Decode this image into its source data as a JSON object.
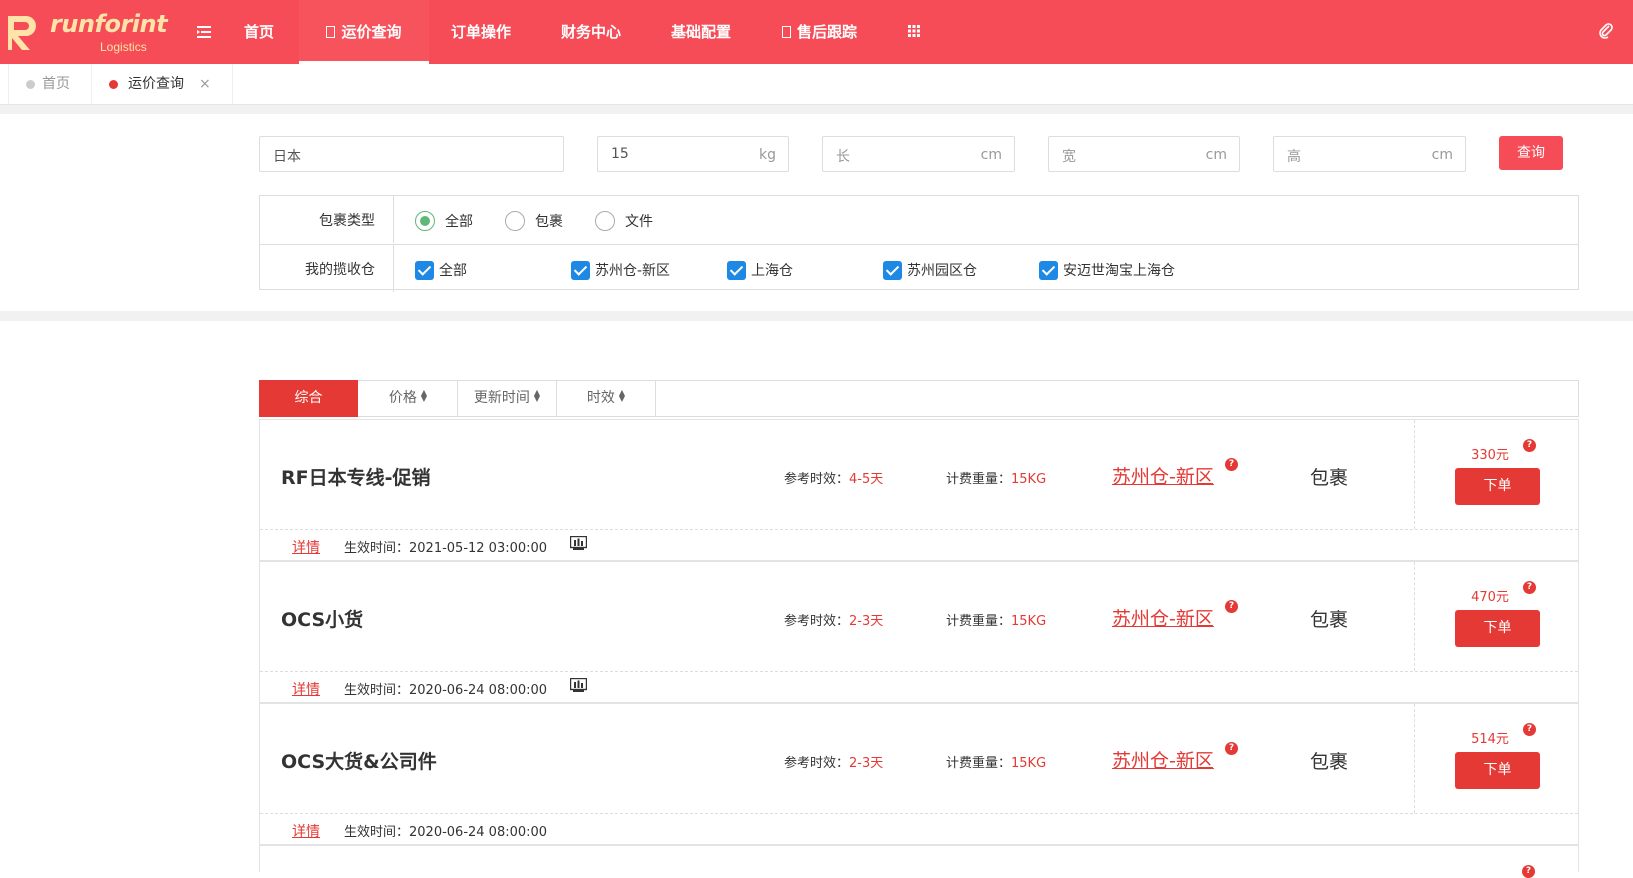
{
  "brand": {
    "name": "runforint",
    "sub": "Logistics"
  },
  "colors": {
    "primary": "#f64c57",
    "accent_red": "#e53935",
    "check_blue": "#1e88e5",
    "radio_green": "#5fb878"
  },
  "nav": [
    {
      "label": "首页"
    },
    {
      "label": "运价查询",
      "active": true
    },
    {
      "label": "订单操作"
    },
    {
      "label": "财务中心"
    },
    {
      "label": "基础配置"
    },
    {
      "label": "售后跟踪"
    }
  ],
  "tabs": [
    {
      "label": "首页"
    },
    {
      "label": "运价查询",
      "close": "×"
    }
  ],
  "search": {
    "country": {
      "value": "日本"
    },
    "weight": {
      "value": "15",
      "unit": "kg"
    },
    "length": {
      "placeholder": "长",
      "unit": "cm"
    },
    "width": {
      "placeholder": "宽",
      "unit": "cm"
    },
    "height": {
      "placeholder": "高",
      "unit": "cm"
    },
    "query_label": "查询"
  },
  "filters": {
    "package_type": {
      "label": "包裹类型",
      "options": [
        {
          "label": "全部",
          "selected": true
        },
        {
          "label": "包裹",
          "selected": false
        },
        {
          "label": "文件",
          "selected": false
        }
      ]
    },
    "warehouse": {
      "label": "我的揽收仓",
      "options": [
        {
          "label": "全部",
          "checked": true
        },
        {
          "label": "苏州仓-新区",
          "checked": true
        },
        {
          "label": "上海仓",
          "checked": true
        },
        {
          "label": "苏州园区仓",
          "checked": true
        },
        {
          "label": "安迈世淘宝上海仓",
          "checked": true
        }
      ]
    }
  },
  "sort_bar": [
    {
      "label": "综合",
      "active": true
    },
    {
      "label": "价格"
    },
    {
      "label": "更新时间"
    },
    {
      "label": "时效"
    }
  ],
  "results": [
    {
      "name": "RF日本专线-促销",
      "time_label": "参考时效：",
      "time_value": "4-5天",
      "weight_label": "计费重量：",
      "weight_value": "15KG",
      "warehouse": "苏州仓-新区",
      "type": "包裹",
      "price": "330元",
      "order_label": "下单",
      "detail_label": "详情",
      "effective": "生效时间：2021-05-12 03:00:00",
      "has_chart": true
    },
    {
      "name": "OCS小货",
      "time_label": "参考时效：",
      "time_value": "2-3天",
      "weight_label": "计费重量：",
      "weight_value": "15KG",
      "warehouse": "苏州仓-新区",
      "type": "包裹",
      "price": "470元",
      "order_label": "下单",
      "detail_label": "详情",
      "effective": "生效时间：2020-06-24 08:00:00",
      "has_chart": true
    },
    {
      "name": "OCS大货&公司件",
      "time_label": "参考时效：",
      "time_value": "2-3天",
      "weight_label": "计费重量：",
      "weight_value": "15KG",
      "warehouse": "苏州仓-新区",
      "type": "包裹",
      "price": "514元",
      "order_label": "下单",
      "detail_label": "详情",
      "effective": "生效时间：2020-06-24 08:00:00",
      "has_chart": false
    }
  ],
  "help_mark": "?",
  "icons": [
    "menu-toggle-icon",
    "apps-grid-icon",
    "attachment-icon",
    "chart-icon",
    "help-icon"
  ]
}
